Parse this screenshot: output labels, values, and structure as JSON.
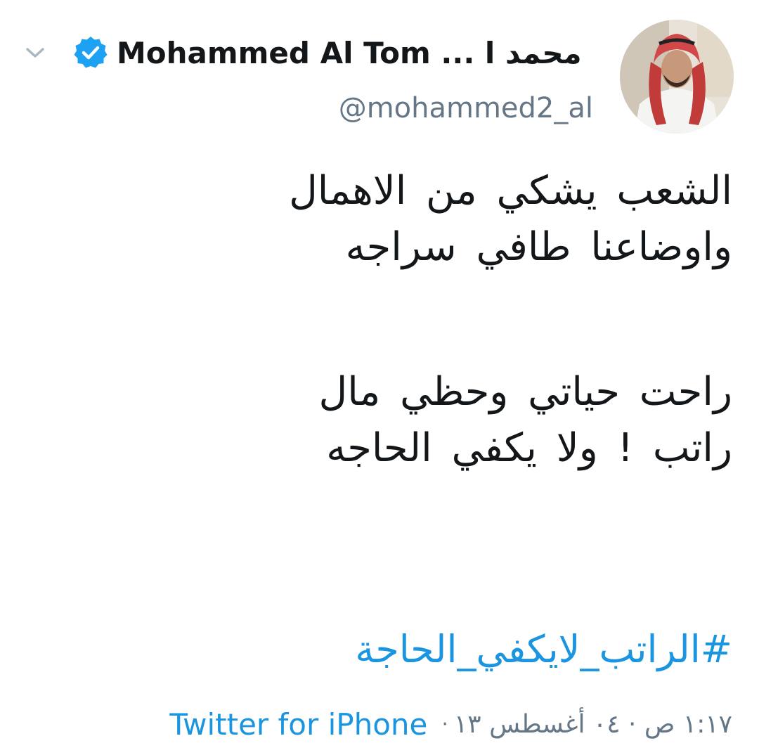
{
  "header": {
    "display_name": "Mohammed Al Tom ... محمد ا",
    "handle": "@mohammed2_al",
    "verified_icon": "verified-badge-icon",
    "menu_icon": "chevron-down-icon"
  },
  "tweet": {
    "lines": [
      "الشعب يشكي من الاهمال",
      "واوضاعنا طافي سراجه",
      "راحت حياتي وحظي مال",
      "راتب ! ولا يكفي الحاجه"
    ],
    "hashtag": "#الراتب_لايكفي_الحاجة"
  },
  "meta": {
    "source": "Twitter for iPhone",
    "separator": "·",
    "timestamp": "١:١٧ ص · ٠٤ أغسطس ١٣"
  },
  "colors": {
    "link": "#1b95e0",
    "secondary_text": "#657786",
    "primary_text": "#14171a",
    "verified": "#1da1f2"
  }
}
